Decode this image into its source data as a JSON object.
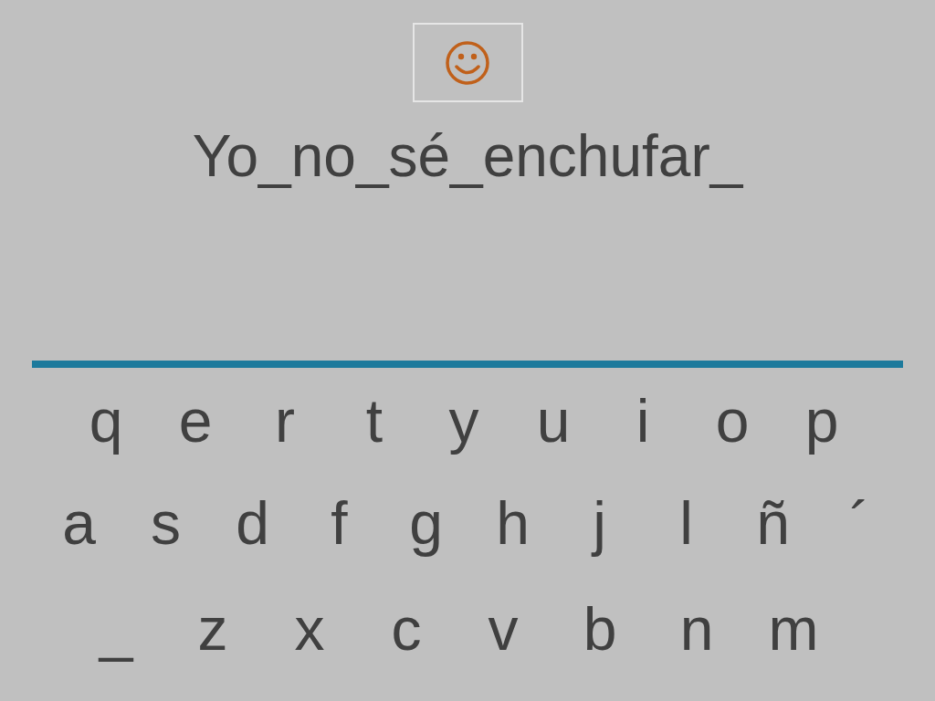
{
  "answer": {
    "text": "Yo_no_sé_enchufar_"
  },
  "keyboard": {
    "rows": [
      [
        "q",
        "e",
        "r",
        "t",
        "y",
        "u",
        "i",
        "o",
        "p"
      ],
      [
        "a",
        "s",
        "d",
        "f",
        "g",
        "h",
        "j",
        "l",
        "ñ",
        "´"
      ],
      [
        "_",
        "z",
        "x",
        "c",
        "v",
        "b",
        "n",
        "m"
      ]
    ]
  }
}
